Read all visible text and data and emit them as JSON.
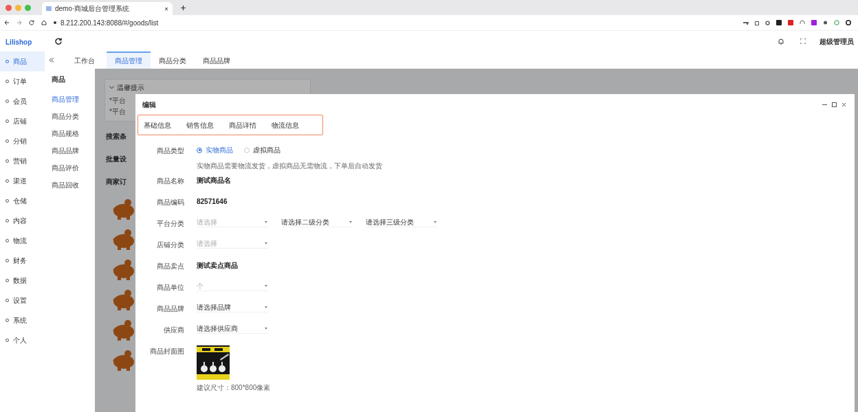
{
  "browser": {
    "tab_title": "demo·商城后台管理系统",
    "url": "8.212.200.143:8088/#/goods/list"
  },
  "app": {
    "logo": "Lilishop",
    "user": "超级管理员"
  },
  "sidebar": {
    "items": [
      {
        "label": "商品",
        "selected": true
      },
      {
        "label": "订单",
        "selected": false
      },
      {
        "label": "会员",
        "selected": false
      },
      {
        "label": "店铺",
        "selected": false
      },
      {
        "label": "分销",
        "selected": false
      },
      {
        "label": "营销",
        "selected": false
      },
      {
        "label": "渠道",
        "selected": false
      },
      {
        "label": "仓储",
        "selected": false
      },
      {
        "label": "内容",
        "selected": false
      },
      {
        "label": "物流",
        "selected": false
      },
      {
        "label": "财务",
        "selected": false
      },
      {
        "label": "数据",
        "selected": false
      },
      {
        "label": "设置",
        "selected": false
      },
      {
        "label": "系统",
        "selected": false
      },
      {
        "label": "个人",
        "selected": false
      }
    ]
  },
  "top_tabs": [
    {
      "label": "工作台",
      "selected": false
    },
    {
      "label": "商品管理",
      "selected": true
    },
    {
      "label": "商品分类",
      "selected": false
    },
    {
      "label": "商品品牌",
      "selected": false
    }
  ],
  "submenu": {
    "title": "商品",
    "items": [
      {
        "label": "商品管理",
        "selected": true
      },
      {
        "label": "商品分类",
        "selected": false
      },
      {
        "label": "商品规格",
        "selected": false
      },
      {
        "label": "商品品牌",
        "selected": false
      },
      {
        "label": "商品评价",
        "selected": false
      },
      {
        "label": "商品回收",
        "selected": false
      }
    ]
  },
  "background": {
    "notice_title": "温馨提示",
    "notice_lines": [
      "*平台",
      "*平台"
    ],
    "labels": [
      "搜索条",
      "批量设",
      "商家订"
    ]
  },
  "dialog": {
    "title": "编辑",
    "tabs": [
      "基础信息",
      "销售信息",
      "商品详情",
      "物流信息"
    ],
    "form": [
      {
        "kind": "radio",
        "label": "商品类型",
        "options": [
          {
            "label": "实物商品",
            "selected": true
          },
          {
            "label": "虚拟商品",
            "selected": false
          }
        ],
        "hint": "实物商品需要物流发货，虚拟商品无需物流，下单后自动发货"
      },
      {
        "kind": "text",
        "label": "商品名称",
        "value": "测试商品名"
      },
      {
        "kind": "text",
        "label": "商品编码",
        "value": "82571646"
      },
      {
        "kind": "select",
        "label": "平台分类",
        "selects": [
          {
            "placeholder": "请选择"
          },
          {
            "value": "请选择二级分类"
          },
          {
            "value": "请选择三级分类"
          }
        ]
      },
      {
        "kind": "select",
        "label": "店铺分类",
        "selects": [
          {
            "placeholder": "请选择"
          }
        ]
      },
      {
        "kind": "text",
        "label": "商品卖点",
        "value": "测试卖点商品"
      },
      {
        "kind": "select",
        "label": "商品单位",
        "selects": [
          {
            "placeholder": "个"
          }
        ]
      },
      {
        "kind": "select",
        "label": "商品品牌",
        "selects": [
          {
            "value": "请选择品牌"
          }
        ]
      },
      {
        "kind": "select",
        "label": "供应商",
        "selects": [
          {
            "value": "请选择供应商"
          }
        ]
      },
      {
        "label": "商品封面图",
        "caption": "建议尺寸：800*800像素"
      }
    ]
  }
}
